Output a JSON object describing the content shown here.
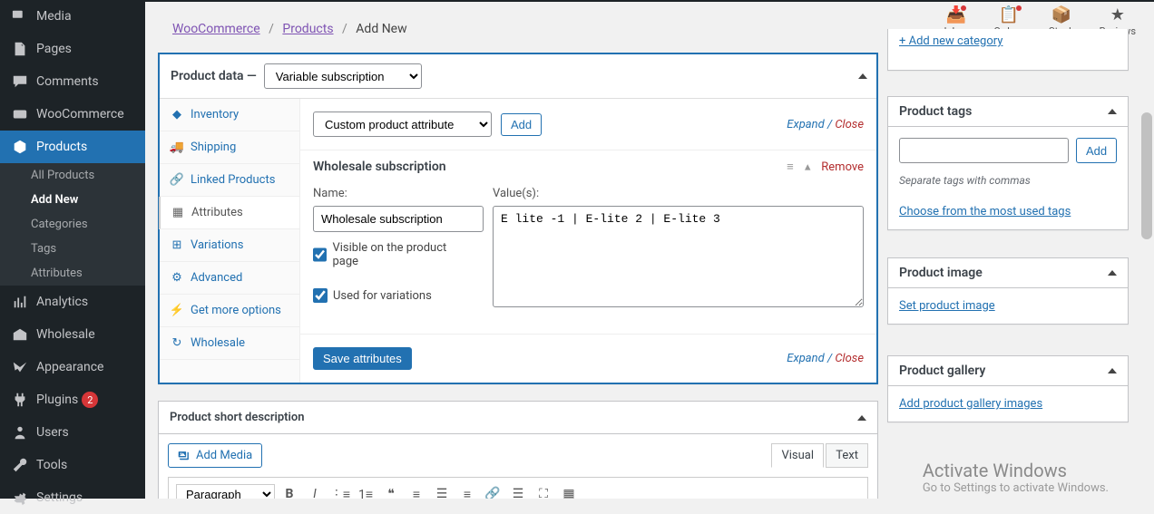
{
  "adminmenu": [
    {
      "label": "Media",
      "icon": "media"
    },
    {
      "label": "Pages",
      "icon": "page"
    },
    {
      "label": "Comments",
      "icon": "comment"
    },
    {
      "label": "WooCommerce",
      "icon": "woo"
    },
    {
      "label": "Products",
      "icon": "products",
      "current": true,
      "submenu": [
        {
          "label": "All Products"
        },
        {
          "label": "Add New",
          "current": true
        },
        {
          "label": "Categories"
        },
        {
          "label": "Tags"
        },
        {
          "label": "Attributes"
        }
      ]
    },
    {
      "label": "Analytics",
      "icon": "analytics"
    },
    {
      "label": "Wholesale",
      "icon": "wholesale"
    },
    {
      "label": "Appearance",
      "icon": "appearance"
    },
    {
      "label": "Plugins",
      "icon": "plugins",
      "badge": "2"
    },
    {
      "label": "Users",
      "icon": "users"
    },
    {
      "label": "Tools",
      "icon": "tools"
    },
    {
      "label": "Settings",
      "icon": "settings"
    }
  ],
  "header_tools": [
    {
      "label": "Inbox",
      "icon": "📥",
      "dot": true
    },
    {
      "label": "Orders",
      "icon": "📋",
      "dot": true
    },
    {
      "label": "Stock",
      "icon": "📦"
    },
    {
      "label": "Reviews",
      "icon": "★"
    }
  ],
  "breadcrumb": {
    "a": "WooCommerce",
    "b": "Products",
    "c": "Add New"
  },
  "product_data": {
    "title": "Product data —",
    "type_select": "Variable subscription",
    "tabs": [
      {
        "label": "Inventory",
        "icon": "inv"
      },
      {
        "label": "Shipping",
        "icon": "ship"
      },
      {
        "label": "Linked Products",
        "icon": "link"
      },
      {
        "label": "Attributes",
        "icon": "attr",
        "active": true
      },
      {
        "label": "Variations",
        "icon": "var"
      },
      {
        "label": "Advanced",
        "icon": "adv"
      },
      {
        "label": "Get more options",
        "icon": "more"
      },
      {
        "label": "Wholesale",
        "icon": "whole"
      }
    ],
    "attr_select": "Custom product attribute",
    "add_btn": "Add",
    "expand": "Expand",
    "close": "Close",
    "attribute": {
      "title": "Wholesale subscription",
      "remove": "Remove",
      "name_label": "Name:",
      "name_value": "Wholesale subscription",
      "values_label": "Value(s):",
      "values_value": "E lite -1 | E-lite 2 | E-lite 3",
      "visible": "Visible on the product page",
      "used": "Used for variations"
    },
    "save_btn": "Save attributes"
  },
  "short_desc": {
    "title": "Product short description",
    "add_media": "Add Media",
    "tabs": {
      "visual": "Visual",
      "text": "Text"
    },
    "format_select": "Paragraph"
  },
  "sideboxes": {
    "addcat": "+ Add new category",
    "tags": {
      "title": "Product tags",
      "add": "Add",
      "desc": "Separate tags with commas",
      "link": "Choose from the most used tags"
    },
    "image": {
      "title": "Product image",
      "link": "Set product image"
    },
    "gallery": {
      "title": "Product gallery",
      "link": "Add product gallery images"
    }
  },
  "activate": {
    "t1": "Activate Windows",
    "t2": "Go to Settings to activate Windows."
  }
}
